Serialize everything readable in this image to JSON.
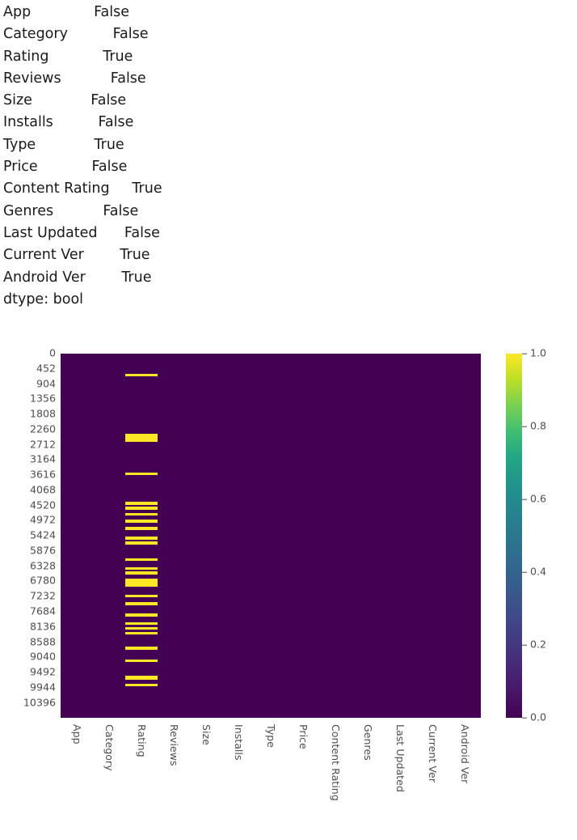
{
  "series_output": {
    "rows": [
      {
        "index": "App",
        "value": "False",
        "pad": 14
      },
      {
        "index": "Category",
        "value": "False",
        "pad": 10
      },
      {
        "index": "Rating",
        "value": "True",
        "pad": 12
      },
      {
        "index": "Reviews",
        "value": "False",
        "pad": 11
      },
      {
        "index": "Size",
        "value": "False",
        "pad": 13
      },
      {
        "index": "Installs",
        "value": "False",
        "pad": 10
      },
      {
        "index": "Type",
        "value": "True",
        "pad": 13
      },
      {
        "index": "Price",
        "value": "False",
        "pad": 12
      },
      {
        "index": "Content Rating",
        "value": "True",
        "pad": 5
      },
      {
        "index": "Genres",
        "value": "False",
        "pad": 11
      },
      {
        "index": "Last Updated",
        "value": "False",
        "pad": 6
      },
      {
        "index": "Current Ver",
        "value": "True",
        "pad": 8
      },
      {
        "index": "Android Ver",
        "value": "True",
        "pad": 8
      }
    ],
    "dtype_line": "dtype: bool"
  },
  "chart_data": {
    "type": "heatmap",
    "title": "",
    "xlabel": "",
    "ylabel": "",
    "colormap": "viridis",
    "grid": false,
    "colorbar": {
      "vmin": 0.0,
      "vmax": 1.0,
      "ticks": [
        0.0,
        0.2,
        0.4,
        0.6,
        0.8,
        1.0
      ],
      "tick_labels": [
        "0.0",
        "0.2",
        "0.4",
        "0.6",
        "0.8",
        "1.0"
      ],
      "position": "right",
      "low_color": "#440154",
      "high_color": "#fde725"
    },
    "columns": [
      "App",
      "Category",
      "Rating",
      "Reviews",
      "Size",
      "Installs",
      "Type",
      "Price",
      "Content Rating",
      "Genres",
      "Last Updated",
      "Current Ver",
      "Android Ver"
    ],
    "y_range": [
      0,
      10840
    ],
    "y_ticks": [
      0,
      452,
      904,
      1356,
      1808,
      2260,
      2712,
      3164,
      3616,
      4068,
      4520,
      4972,
      5424,
      5876,
      6328,
      6780,
      7232,
      7684,
      8136,
      8588,
      9040,
      9492,
      9944,
      10396
    ],
    "y_tick_labels": [
      "0",
      "452",
      "904",
      "1356",
      "1808",
      "2260",
      "2712",
      "3164",
      "3616",
      "4068",
      "4520",
      "4972",
      "5424",
      "5876",
      "6328",
      "6780",
      "7232",
      "7684",
      "8136",
      "8588",
      "9040",
      "9492",
      "9944",
      "10396"
    ],
    "description": "Missing-value map: only the 'Rating' column contains True (missing) rows; all other columns are entirely False.",
    "missing_column": "Rating",
    "missing_row_bands": [
      {
        "start": 600,
        "end": 680
      },
      {
        "start": 2380,
        "end": 2620
      },
      {
        "start": 3530,
        "end": 3610
      },
      {
        "start": 4420,
        "end": 4500
      },
      {
        "start": 4560,
        "end": 4640
      },
      {
        "start": 4740,
        "end": 4820
      },
      {
        "start": 4950,
        "end": 5030
      },
      {
        "start": 5160,
        "end": 5240
      },
      {
        "start": 5450,
        "end": 5530
      },
      {
        "start": 5600,
        "end": 5680
      },
      {
        "start": 6090,
        "end": 6170
      },
      {
        "start": 6350,
        "end": 6430
      },
      {
        "start": 6490,
        "end": 6570
      },
      {
        "start": 6700,
        "end": 6930
      },
      {
        "start": 7180,
        "end": 7260
      },
      {
        "start": 7400,
        "end": 7480
      },
      {
        "start": 7740,
        "end": 7820
      },
      {
        "start": 8000,
        "end": 8080
      },
      {
        "start": 8140,
        "end": 8220
      },
      {
        "start": 8280,
        "end": 8360
      },
      {
        "start": 8730,
        "end": 8810
      },
      {
        "start": 9100,
        "end": 9180
      },
      {
        "start": 9580,
        "end": 9700
      },
      {
        "start": 9820,
        "end": 9900
      }
    ]
  }
}
